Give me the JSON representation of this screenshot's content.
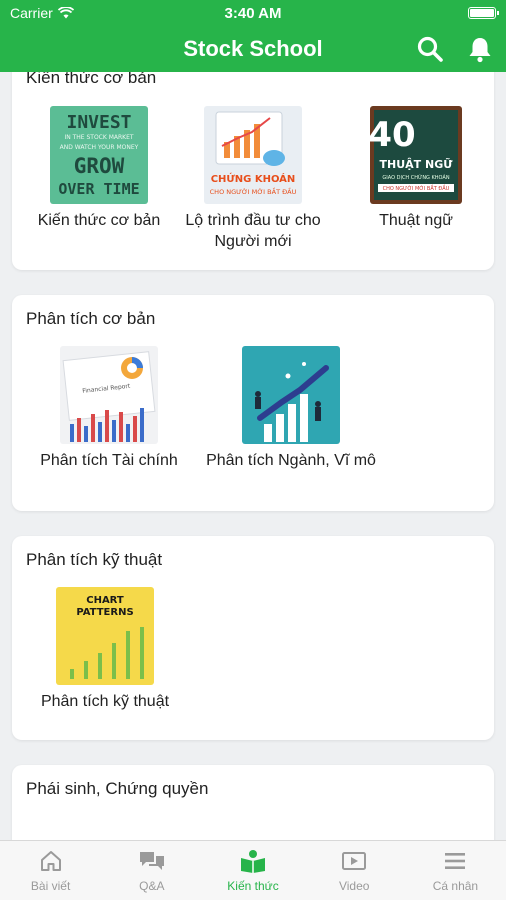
{
  "status": {
    "carrier": "Carrier",
    "time": "3:40 AM"
  },
  "header": {
    "title": "Stock School"
  },
  "sections": [
    {
      "title": "Kiến thức cơ bản",
      "items": [
        {
          "label": "Kiến thức cơ bản",
          "thumb_text": [
            "INVEST",
            "IN THE STOCK MARKET",
            "AND WATCH YOUR MONEY",
            "GROW",
            "OVER TIME"
          ]
        },
        {
          "label": "Lộ trình đầu tư cho Người mới",
          "thumb_text": [
            "CHỨNG KHOÁN",
            "CHO NGƯỜI MỚI BẮT ĐẦU"
          ]
        },
        {
          "label": "Thuật ngữ",
          "thumb_text": [
            "40",
            "THUẬT NGỮ",
            "GIAO DỊCH CHỨNG KHOÁN",
            "CHO NGƯỜI MỚI BẮT ĐẦU"
          ]
        }
      ]
    },
    {
      "title": "Phân tích cơ bản",
      "items": [
        {
          "label": "Phân tích Tài chính",
          "thumb_text": [
            "Financial Report"
          ]
        },
        {
          "label": "Phân tích Ngành, Vĩ mô"
        }
      ]
    },
    {
      "title": "Phân tích kỹ thuật",
      "items": [
        {
          "label": "Phân tích kỹ thuật",
          "thumb_text": [
            "CHART",
            "PATTERNS"
          ]
        }
      ]
    },
    {
      "title": "Phái sinh, Chứng quyền",
      "items": []
    }
  ],
  "tabs": [
    {
      "label": "Bài viết",
      "icon": "home-icon"
    },
    {
      "label": "Q&A",
      "icon": "chat-icon"
    },
    {
      "label": "Kiến thức",
      "icon": "book-icon",
      "active": true
    },
    {
      "label": "Video",
      "icon": "video-icon"
    },
    {
      "label": "Cá nhân",
      "icon": "menu-icon"
    }
  ],
  "colors": {
    "brand": "#27b44a",
    "tab_inactive": "#9a9a9a",
    "background": "#eef0f2"
  }
}
